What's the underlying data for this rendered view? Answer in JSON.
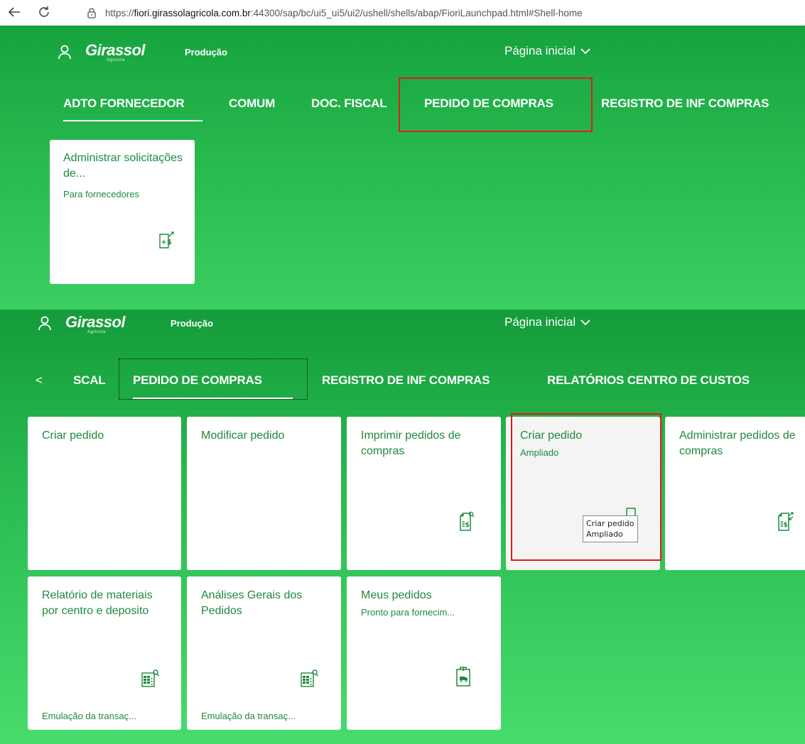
{
  "browser": {
    "back_icon": "arrow-left-icon",
    "reload_icon": "reload-icon",
    "url_prefix": "https://",
    "url_host": "fiori.girassolagricola.com.br",
    "url_rest": ":44300/sap/bc/ui5_ui5/ui2/ushell/shells/abap/FioriLaunchpad.html#Shell-home"
  },
  "shell": {
    "logo_text": "Girassol",
    "logo_sub": "Agricola",
    "environment": "Produção",
    "home_title": "Página inicial"
  },
  "panel1": {
    "tabs": [
      {
        "label": "ADTO FORNECEDOR"
      },
      {
        "label": "COMUM"
      },
      {
        "label": "DOC. FISCAL"
      },
      {
        "label": "PEDIDO DE COMPRAS"
      },
      {
        "label": "REGISTRO DE INF COMPRAS"
      }
    ],
    "tiles": [
      {
        "title": "Administrar solicitações de...",
        "subtitle": "Para fornecedores",
        "icon": "money-add-document-icon"
      }
    ]
  },
  "panel2": {
    "scroll_left_label": "<",
    "tabs": [
      {
        "label": "SCAL"
      },
      {
        "label": "PEDIDO DE COMPRAS"
      },
      {
        "label": "REGISTRO DE INF COMPRAS"
      },
      {
        "label": "RELATÓRIOS CENTRO DE CUSTOS"
      }
    ],
    "tiles": [
      {
        "title": "Criar pedido",
        "subtitle": "",
        "footer": ""
      },
      {
        "title": "Modificar pedido",
        "subtitle": "",
        "footer": ""
      },
      {
        "title": "Imprimir pedidos de compras",
        "subtitle": "",
        "footer": "",
        "icon": "money-document-search-icon"
      },
      {
        "title": "Criar pedido",
        "subtitle": "Ampliado",
        "footer": ""
      },
      {
        "title": "Administrar pedidos de compras",
        "subtitle": "",
        "footer": "",
        "icon": "money-document-transfer-icon"
      },
      {
        "title": "Relatório de materiais por centro e deposito",
        "subtitle": "",
        "footer": "Emulação da transaç...",
        "icon": "table-search-icon"
      },
      {
        "title": "Análises Gerais dos Pedidos",
        "subtitle": "",
        "footer": "Emulação da transaç...",
        "icon": "table-search-icon"
      },
      {
        "title": "Meus pedidos",
        "subtitle": "Pronto para fornecim...",
        "footer": "",
        "icon": "clipboard-truck-icon"
      }
    ],
    "tooltip": {
      "line1": "Criar pedido",
      "line2": "Ampliado"
    }
  },
  "colors": {
    "shell_green": "#1fae46",
    "tile_text": "#1e8a3b",
    "highlight_red": "#e21b1b"
  }
}
